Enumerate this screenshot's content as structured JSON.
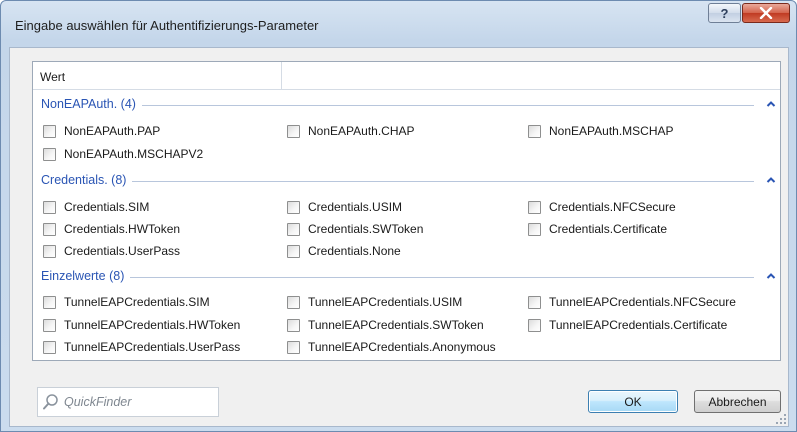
{
  "window": {
    "title": "Eingabe auswählen für Authentifizierungs-Parameter",
    "help_label": "?"
  },
  "list": {
    "column_header": "Wert",
    "groups": [
      {
        "title": "NonEAPAuth. (4)",
        "items": [
          "NonEAPAuth.PAP",
          "NonEAPAuth.CHAP",
          "NonEAPAuth.MSCHAP",
          "NonEAPAuth.MSCHAPV2"
        ]
      },
      {
        "title": "Credentials. (8)",
        "items": [
          "Credentials.SIM",
          "Credentials.USIM",
          "Credentials.NFCSecure",
          "Credentials.HWToken",
          "Credentials.SWToken",
          "Credentials.Certificate",
          "Credentials.UserPass",
          "Credentials.None"
        ]
      },
      {
        "title": "Einzelwerte (8)",
        "items": [
          "TunnelEAPCredentials.SIM",
          "TunnelEAPCredentials.USIM",
          "TunnelEAPCredentials.NFCSecure",
          "TunnelEAPCredentials.HWToken",
          "TunnelEAPCredentials.SWToken",
          "TunnelEAPCredentials.Certificate",
          "TunnelEAPCredentials.UserPass",
          "TunnelEAPCredentials.Anonymous"
        ]
      }
    ]
  },
  "footer": {
    "quickfinder_placeholder": "QuickFinder",
    "ok_label": "OK",
    "cancel_label": "Abbrechen"
  },
  "colors": {
    "group_title": "#2a55b4",
    "ok_border": "#3c7fb1",
    "close_button": "#c03a22"
  },
  "icons": [
    "help-icon",
    "close-icon",
    "chevron-up-icon",
    "search-icon",
    "resize-grip-icon"
  ]
}
